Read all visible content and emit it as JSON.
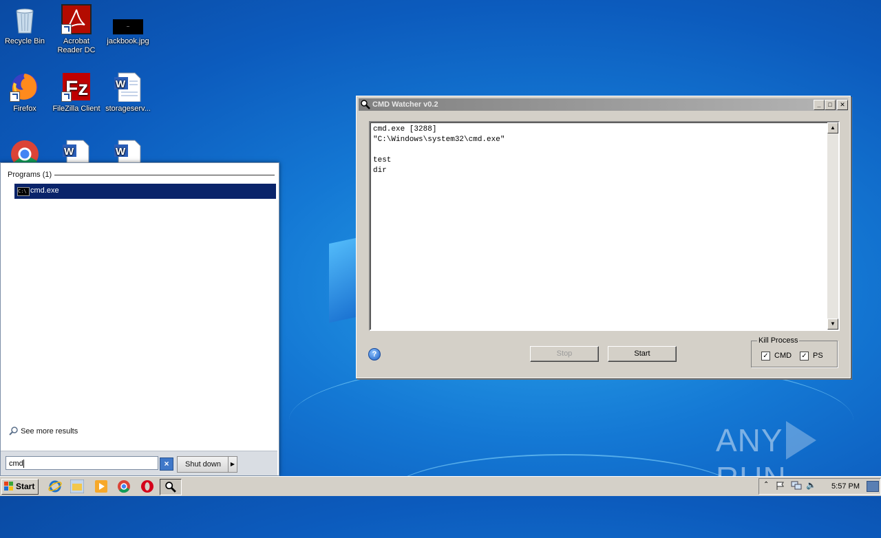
{
  "desktop": {
    "icons": [
      {
        "label": "Recycle Bin"
      },
      {
        "label": "Acrobat\nReader DC"
      },
      {
        "label": "jackbook.jpg"
      },
      {
        "label": "Firefox"
      },
      {
        "label": "FileZilla Client"
      },
      {
        "label": "storageserv..."
      }
    ]
  },
  "start_menu": {
    "section_header": "Programs (1)",
    "programs": [
      {
        "label": "cmd.exe",
        "icon_text": "C:\\"
      }
    ],
    "see_more": "See more results",
    "search_value": "cmd",
    "shutdown_label": "Shut down"
  },
  "window": {
    "title": "CMD Watcher v0.2",
    "log_text": "cmd.exe [3288]\n\"C:\\Windows\\system32\\cmd.exe\"\n\ntest\ndir",
    "stop_label": "Stop",
    "start_label": "Start",
    "kill_process": {
      "legend": "Kill Process",
      "cmd_label": "CMD",
      "ps_label": "PS",
      "cmd_checked": true,
      "ps_checked": true
    }
  },
  "taskbar": {
    "start_label": "Start",
    "clock": "5:57 PM"
  },
  "watermark": {
    "left": "ANY",
    "right": "RUN"
  },
  "colors": {
    "selection": "#0a246a",
    "desktop": "#1478d4",
    "window_face": "#d4d0c8"
  }
}
